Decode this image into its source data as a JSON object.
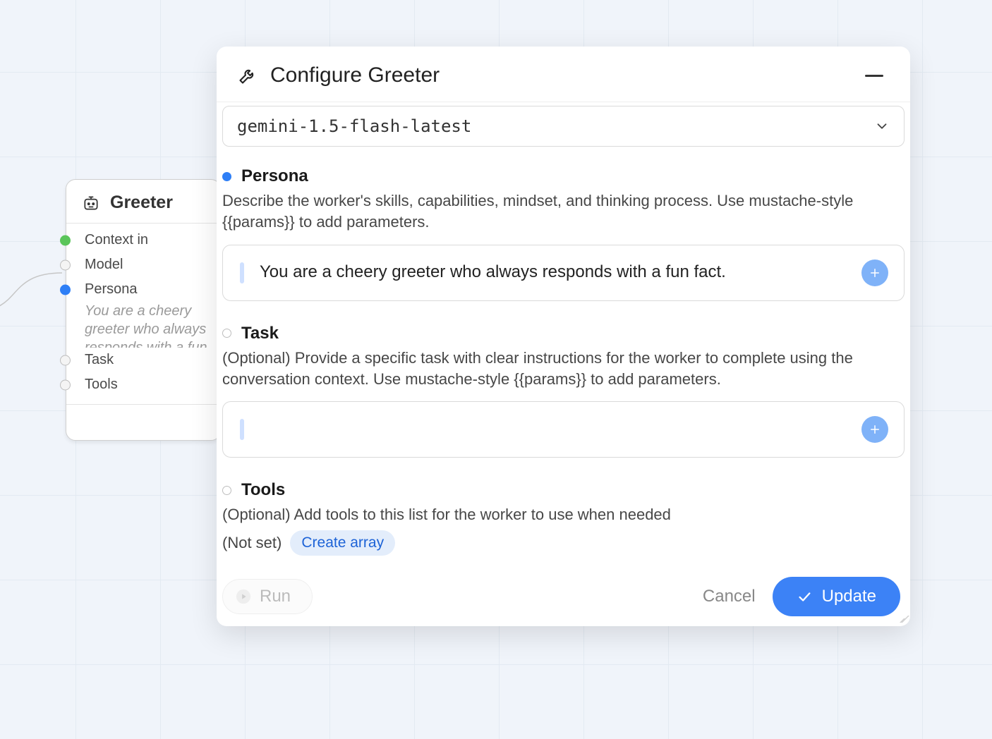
{
  "node": {
    "title": "Greeter",
    "ports": [
      {
        "label": "Context in",
        "dot": "green"
      },
      {
        "label": "Model",
        "dot": "grey"
      },
      {
        "label": "Persona",
        "dot": "blue"
      },
      {
        "label": "Task",
        "dot": "grey"
      },
      {
        "label": "Tools",
        "dot": "grey"
      }
    ],
    "persona_preview": "You are a cheery greeter who always responds with a fun fact..."
  },
  "panel": {
    "title": "Configure Greeter",
    "model": "gemini-1.5-flash-latest",
    "sections": {
      "persona": {
        "label": "Persona",
        "description": "Describe the worker's skills, capabilities, mindset, and thinking process. Use mustache-style {{params}} to add parameters.",
        "value": "You are a cheery greeter who always responds with a fun fact."
      },
      "task": {
        "label": "Task",
        "description": "(Optional) Provide a specific task with clear instructions for the worker to complete using the conversation context. Use mustache-style {{params}} to add parameters.",
        "value": ""
      },
      "tools": {
        "label": "Tools",
        "description": "(Optional) Add tools to this list for the worker to use when needed",
        "not_set_label": "(Not set)",
        "chip_label": "Create array"
      }
    },
    "footer": {
      "run_label": "Run",
      "cancel_label": "Cancel",
      "update_label": "Update"
    }
  }
}
